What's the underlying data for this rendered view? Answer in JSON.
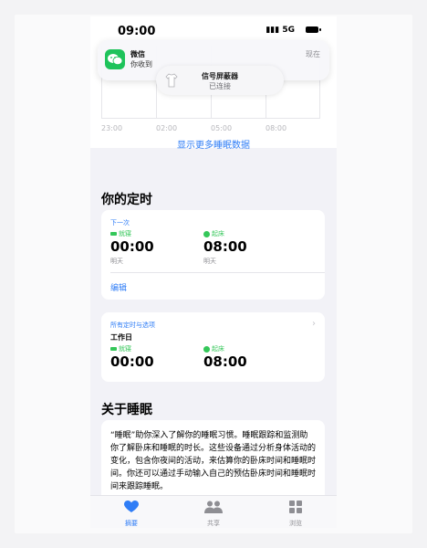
{
  "status_bar": {
    "time": "09:00",
    "signal": "5G"
  },
  "notification": {
    "app_name": "微信",
    "body": "你收到",
    "time": "现在",
    "popup_title": "信号屏蔽器",
    "popup_status": "已连接"
  },
  "sleep_chart": {
    "tick_labels": [
      "23:00",
      "02:00",
      "05:00",
      "08:00"
    ],
    "more_link": "显示更多睡眠数据"
  },
  "schedule": {
    "title": "你的定时",
    "next": {
      "heading": "下一次",
      "bedtime_label": "就寝",
      "bedtime": "00:00",
      "bedtime_day": "明天",
      "wake_label": "起床",
      "wake": "08:00",
      "wake_day": "明天",
      "edit": "编辑"
    },
    "all": {
      "heading": "所有定时与选项",
      "workday": "工作日",
      "bedtime_label": "就寝",
      "bedtime": "00:00",
      "wake_label": "起床",
      "wake": "08:00"
    }
  },
  "about": {
    "title": "关于睡眠",
    "text": "“睡眠”助你深入了解你的睡眠习惯。睡眠跟踪和监测助你了解卧床和睡眠的时长。这些设备通过分析身体活动的变化，包含你夜间的活动，来估算你的卧床时间和睡眠时间。你还可以通过手动输入自己的预估卧床时间和睡眠时间来跟踪睡眠。"
  },
  "tabs": [
    {
      "label": "摘要",
      "icon": "heart-icon",
      "active": true
    },
    {
      "label": "共享",
      "icon": "people-icon",
      "active": false
    },
    {
      "label": "浏览",
      "icon": "grid-icon",
      "active": false
    }
  ],
  "colors": {
    "accent": "#2f7df6",
    "green": "#34c759",
    "wechat": "#1ec35b"
  }
}
